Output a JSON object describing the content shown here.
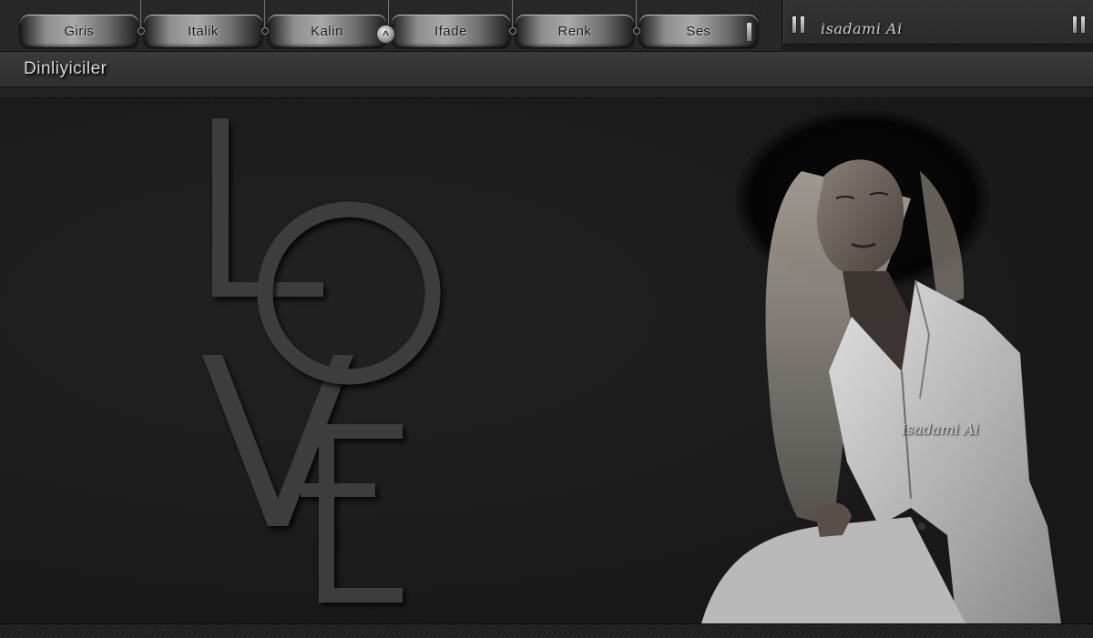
{
  "toolbar": {
    "buttons": [
      {
        "label": "Giris"
      },
      {
        "label": "Italik"
      },
      {
        "label": "Kalin"
      },
      {
        "label": "Ifade"
      },
      {
        "label": "Renk"
      },
      {
        "label": "Ses"
      }
    ],
    "toggle_glyph": "^"
  },
  "user_panel": {
    "name": "isadami Ai"
  },
  "header": {
    "title": "Dinliyiciler"
  },
  "banner": {
    "word": "LOVE",
    "watermark": "isadami Ai",
    "colors": {
      "letters": "#3c3c3c",
      "background": "#1b1b1b",
      "suit": "#c8c8c8"
    }
  }
}
